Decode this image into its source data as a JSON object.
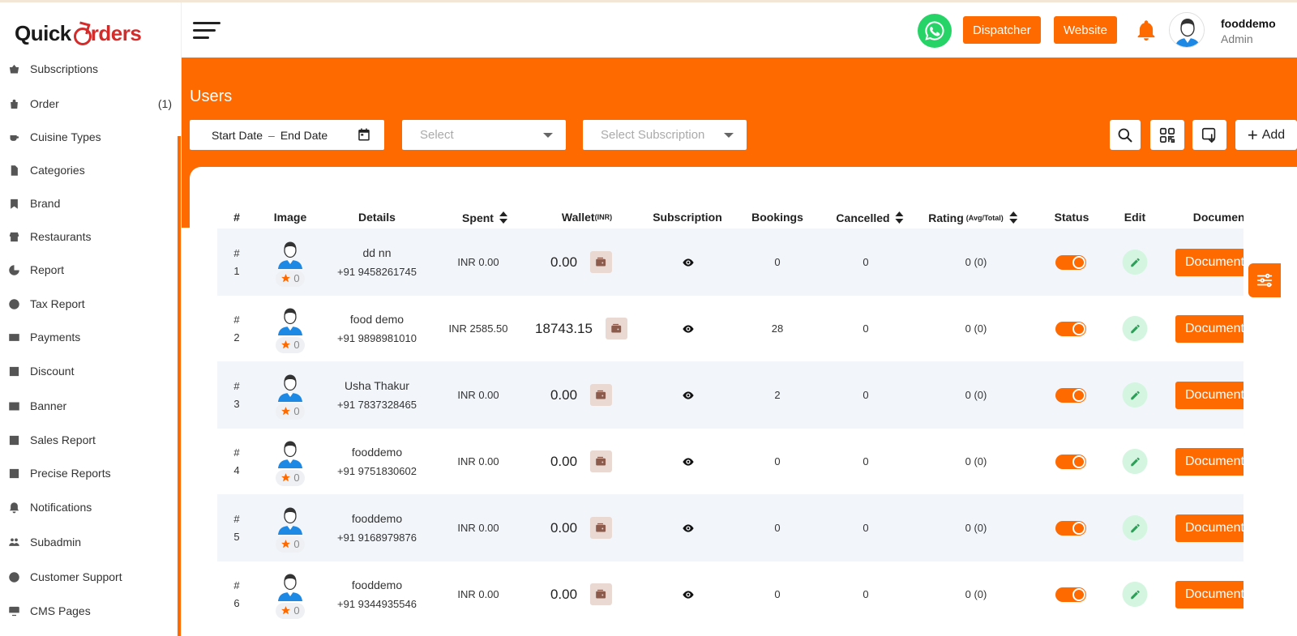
{
  "brand": {
    "part1": "Quick",
    "part2": "rders"
  },
  "sidebar": {
    "items": [
      {
        "label": "Subscriptions",
        "icon": "basket-icon",
        "count": ""
      },
      {
        "label": "Order",
        "icon": "bag-icon",
        "count": "(1)"
      },
      {
        "label": "Cuisine Types",
        "icon": "cup-icon",
        "count": ""
      },
      {
        "label": "Categories",
        "icon": "document-icon",
        "count": ""
      },
      {
        "label": "Brand",
        "icon": "bookmark-icon",
        "count": ""
      },
      {
        "label": "Restaurants",
        "icon": "store-icon",
        "count": ""
      },
      {
        "label": "Report",
        "icon": "report-icon",
        "count": ""
      },
      {
        "label": "Tax Report",
        "icon": "tax-icon",
        "count": ""
      },
      {
        "label": "Payments",
        "icon": "card-icon",
        "count": ""
      },
      {
        "label": "Discount",
        "icon": "discount-icon",
        "count": ""
      },
      {
        "label": "Banner",
        "icon": "image-icon",
        "count": ""
      },
      {
        "label": "Sales Report",
        "icon": "chart-icon",
        "count": ""
      },
      {
        "label": "Precise Reports",
        "icon": "chart-icon",
        "count": ""
      },
      {
        "label": "Notifications",
        "icon": "bell-icon",
        "count": ""
      },
      {
        "label": "Subadmin",
        "icon": "users-icon",
        "count": ""
      },
      {
        "label": "Customer Support",
        "icon": "support-icon",
        "count": ""
      },
      {
        "label": "CMS Pages",
        "icon": "cms-icon",
        "count": ""
      }
    ]
  },
  "header": {
    "dispatcher_label": "Dispatcher",
    "website_label": "Website",
    "user_name": "fooddemo",
    "user_role": "Admin"
  },
  "page": {
    "title": "Users",
    "start_date": "Start Date",
    "date_sep": "–",
    "end_date": "End Date",
    "select_placeholder": "Select",
    "subscription_placeholder": "Select Subscription",
    "add_label": "Add"
  },
  "table": {
    "headers": {
      "index": "#",
      "image": "Image",
      "details": "Details",
      "spent": "Spent",
      "wallet": "Wallet",
      "wallet_unit": "(INR)",
      "subscription": "Subscription",
      "bookings": "Bookings",
      "cancelled": "Cancelled",
      "rating": "Rating",
      "rating_unit": "(Avg/Total)",
      "status": "Status",
      "edit": "Edit",
      "document": "Document"
    },
    "document_label": "Document",
    "rows": [
      {
        "hash": "#",
        "num": "1",
        "stars": "0",
        "name": "dd nn",
        "phone": "+91 9458261745",
        "spent": "INR 0.00",
        "wallet": "0.00",
        "bookings": "0",
        "cancelled": "0",
        "rating": "0 (0)"
      },
      {
        "hash": "#",
        "num": "2",
        "stars": "0",
        "name": "food demo",
        "phone": "+91 9898981010",
        "spent": "INR 2585.50",
        "wallet": "18743.15",
        "bookings": "28",
        "cancelled": "0",
        "rating": "0 (0)"
      },
      {
        "hash": "#",
        "num": "3",
        "stars": "0",
        "name": "Usha Thakur",
        "phone": "+91 7837328465",
        "spent": "INR 0.00",
        "wallet": "0.00",
        "bookings": "2",
        "cancelled": "0",
        "rating": "0 (0)"
      },
      {
        "hash": "#",
        "num": "4",
        "stars": "0",
        "name": "fooddemo",
        "phone": "+91 9751830602",
        "spent": "INR 0.00",
        "wallet": "0.00",
        "bookings": "0",
        "cancelled": "0",
        "rating": "0 (0)"
      },
      {
        "hash": "#",
        "num": "5",
        "stars": "0",
        "name": "fooddemo",
        "phone": "+91 9168979876",
        "spent": "INR 0.00",
        "wallet": "0.00",
        "bookings": "0",
        "cancelled": "0",
        "rating": "0 (0)"
      },
      {
        "hash": "#",
        "num": "6",
        "stars": "0",
        "name": "fooddemo",
        "phone": "+91 9344935546",
        "spent": "INR 0.00",
        "wallet": "0.00",
        "bookings": "0",
        "cancelled": "0",
        "rating": "0 (0)"
      }
    ]
  },
  "colors": {
    "accent": "#ff6a00",
    "whatsapp": "#25d366",
    "logo_red": "#d42b2b",
    "row_alt": "#f2f6fb"
  }
}
